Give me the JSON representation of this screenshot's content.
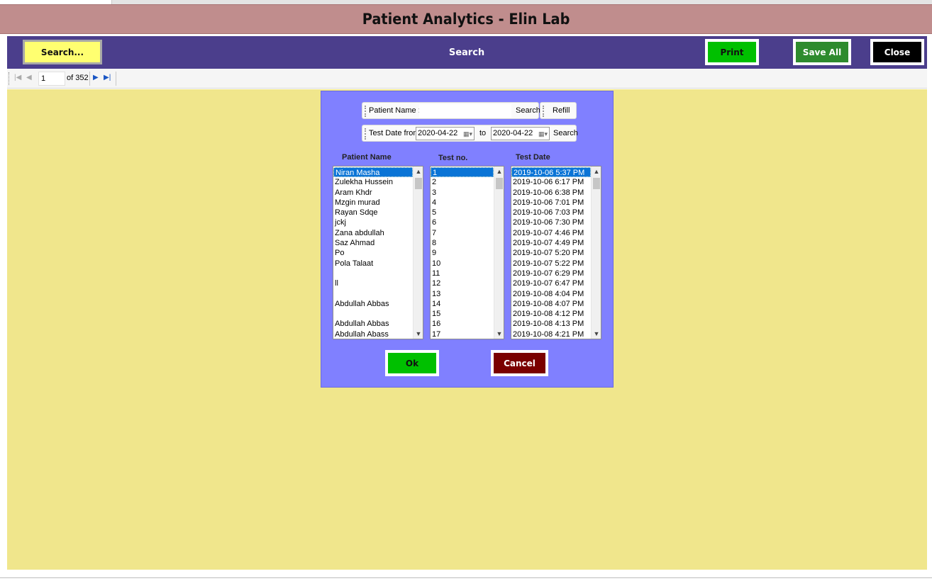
{
  "app": {
    "title": "Patient Analytics - Elin Lab"
  },
  "header": {
    "search_button": "Search...",
    "title": "Search",
    "print_button": "Print",
    "save_all_button": "Save All",
    "close_button": "Close"
  },
  "navigator": {
    "position": "1",
    "count_label": "of 352"
  },
  "dialog": {
    "patient_name_label": "Patient Name :",
    "patient_name_value": "",
    "name_search_button": "Search",
    "refill_button": "Refill",
    "test_date_from_label": "Test Date from:",
    "date_from": "2020-04-22",
    "to_label": "to",
    "date_to": "2020-04-22",
    "date_search_button": "Search",
    "columns": {
      "patient_name": "Patient Name",
      "test_no": "Test no.",
      "test_date": "Test Date"
    },
    "patients": [
      "Niran Masha",
      "Zulekha Hussein",
      "Aram Khdr",
      "Mzgin murad",
      "Rayan Sdqe",
      "jckj",
      "Zana abdullah",
      "Saz Ahmad",
      "Po",
      "Pola Talaat",
      "",
      "ll",
      "",
      "Abdullah Abbas",
      "",
      "Abdullah Abbas",
      "Abdullah Abass"
    ],
    "test_numbers": [
      "1",
      "2",
      "3",
      "4",
      "5",
      "6",
      "7",
      "8",
      "9",
      "10",
      "11",
      "12",
      "13",
      "14",
      "15",
      "16",
      "17"
    ],
    "test_dates": [
      "2019-10-06 5:37 PM",
      "2019-10-06 6:17 PM",
      "2019-10-06 6:38 PM",
      "2019-10-06 7:01 PM",
      "2019-10-06 7:03 PM",
      "2019-10-06 7:30 PM",
      "2019-10-07 4:46 PM",
      "2019-10-07 4:49 PM",
      "2019-10-07 5:20 PM",
      "2019-10-07 5:22 PM",
      "2019-10-07 6:29 PM",
      "2019-10-07 6:47 PM",
      "2019-10-08 4:04 PM",
      "2019-10-08 4:07 PM",
      "2019-10-08 4:12 PM",
      "2019-10-08 4:13 PM",
      "2019-10-08 4:21 PM"
    ],
    "ok_button": "Ok",
    "cancel_button": "Cancel"
  },
  "colors": {
    "title_bar": "#c08d8d",
    "header_bar": "#4b3e8c",
    "workspace": "#f0e68c",
    "dialog": "#8080ff",
    "selection": "#0a74d6"
  }
}
